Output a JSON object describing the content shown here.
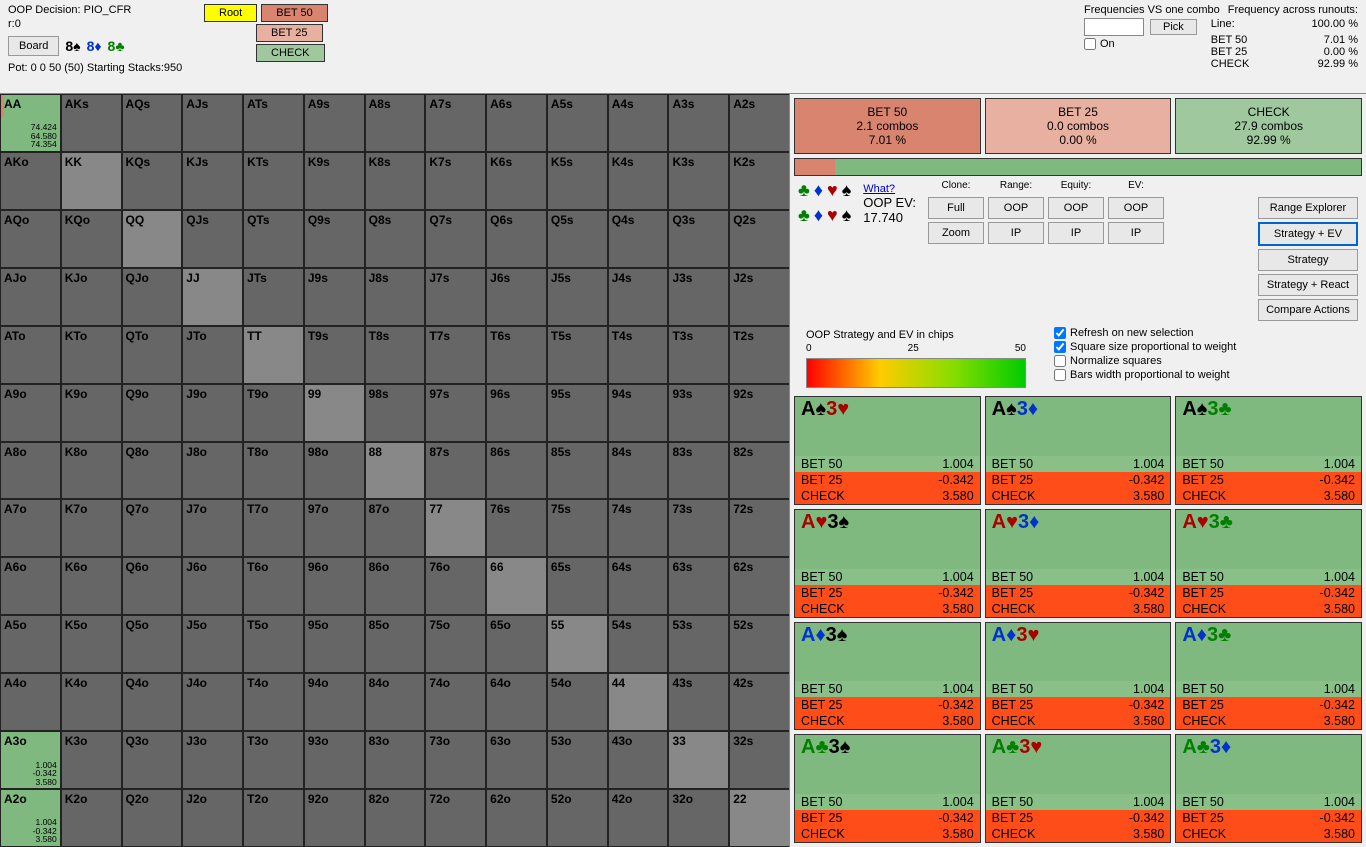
{
  "header": {
    "title": "OOP Decision:  PIO_CFR",
    "r": "r:0",
    "board_btn": "Board",
    "board": [
      {
        "rank": "8",
        "suit": "s"
      },
      {
        "rank": "8",
        "suit": "d"
      },
      {
        "rank": "8",
        "suit": "c"
      }
    ],
    "pot": "Pot: 0 0 50 (50) Starting Stacks:950",
    "tree": {
      "root": "Root",
      "bet50": "BET 50",
      "bet25": "BET 25",
      "check": "CHECK"
    },
    "freq_vs": "Frequencies VS one combo",
    "freq_across": "Frequency across runouts:",
    "pick": "Pick",
    "on": "On",
    "lines": [
      {
        "n": "Line:",
        "v": "100.00 %"
      },
      {
        "n": "BET 50",
        "v": "7.01 %"
      },
      {
        "n": "BET 25",
        "v": "0.00 %"
      },
      {
        "n": "CHECK",
        "v": "92.99 %"
      }
    ]
  },
  "ranks": [
    "A",
    "K",
    "Q",
    "J",
    "T",
    "9",
    "8",
    "7",
    "6",
    "5",
    "4",
    "3",
    "2"
  ],
  "aa": {
    "l1": "74.424",
    "l2": "64.580",
    "l3": "74.354"
  },
  "a3o": {
    "l1": "1.004",
    "l2": "-0.342",
    "l3": "3.580"
  },
  "a2o": {
    "l1": "1.004",
    "l2": "-0.342",
    "l3": "3.580"
  },
  "actions": [
    {
      "name": "BET 50",
      "combos": "2.1 combos",
      "pct": "7.01 %",
      "cls": "bet50"
    },
    {
      "name": "BET 25",
      "combos": "0.0 combos",
      "pct": "0.00 %",
      "cls": "bet25"
    },
    {
      "name": "CHECK",
      "combos": "27.9 combos",
      "pct": "92.99 %",
      "cls": "check"
    }
  ],
  "what": "What?",
  "oop_ev_label": "OOP EV:",
  "oop_ev": "17.740",
  "ctl_cols": [
    {
      "lbl": "Clone:",
      "b1": "Full",
      "b2": "Zoom"
    },
    {
      "lbl": "Range:",
      "b1": "OOP",
      "b2": "IP"
    },
    {
      "lbl": "Equity:",
      "b1": "OOP",
      "b2": "IP"
    },
    {
      "lbl": "EV:",
      "b1": "OOP",
      "b2": "IP"
    }
  ],
  "right_btns": [
    "Range Explorer",
    "Strategy + EV",
    "Strategy",
    "Strategy + React",
    "Compare Actions"
  ],
  "strategy_label": "OOP Strategy and EV in chips",
  "checks": [
    "Refresh on new selection",
    "Square size proportional to weight",
    "Normalize squares",
    "Bars width proportional to weight"
  ],
  "grad": {
    "l": "0",
    "m": "25",
    "r": "50"
  },
  "combos": [
    {
      "c1": {
        "r": "A",
        "s": "s2"
      },
      "c2": {
        "r": "3",
        "s": "h"
      }
    },
    {
      "c1": {
        "r": "A",
        "s": "s2"
      },
      "c2": {
        "r": "3",
        "s": "d2"
      }
    },
    {
      "c1": {
        "r": "A",
        "s": "s2"
      },
      "c2": {
        "r": "3",
        "s": "c2"
      }
    },
    {
      "c1": {
        "r": "A",
        "s": "h"
      },
      "c2": {
        "r": "3",
        "s": "s2"
      }
    },
    {
      "c1": {
        "r": "A",
        "s": "h"
      },
      "c2": {
        "r": "3",
        "s": "d2"
      }
    },
    {
      "c1": {
        "r": "A",
        "s": "h"
      },
      "c2": {
        "r": "3",
        "s": "c2"
      }
    },
    {
      "c1": {
        "r": "A",
        "s": "d2"
      },
      "c2": {
        "r": "3",
        "s": "s2"
      }
    },
    {
      "c1": {
        "r": "A",
        "s": "d2"
      },
      "c2": {
        "r": "3",
        "s": "h"
      }
    },
    {
      "c1": {
        "r": "A",
        "s": "d2"
      },
      "c2": {
        "r": "3",
        "s": "c2"
      }
    },
    {
      "c1": {
        "r": "A",
        "s": "c2"
      },
      "c2": {
        "r": "3",
        "s": "s2"
      }
    },
    {
      "c1": {
        "r": "A",
        "s": "c2"
      },
      "c2": {
        "r": "3",
        "s": "h"
      }
    },
    {
      "c1": {
        "r": "A",
        "s": "c2"
      },
      "c2": {
        "r": "3",
        "s": "d2"
      }
    }
  ],
  "combo_rows": [
    {
      "n": "BET 50",
      "v": "1.004",
      "cls": "b50"
    },
    {
      "n": "BET 25",
      "v": "-0.342",
      "cls": "b25"
    },
    {
      "n": "CHECK",
      "v": "3.580",
      "cls": "chk"
    }
  ],
  "suit_glyph": {
    "s": "♠",
    "d": "♦",
    "c": "♣",
    "h": "♥",
    "s2": "♠",
    "d2": "♦",
    "c2": "♣"
  }
}
